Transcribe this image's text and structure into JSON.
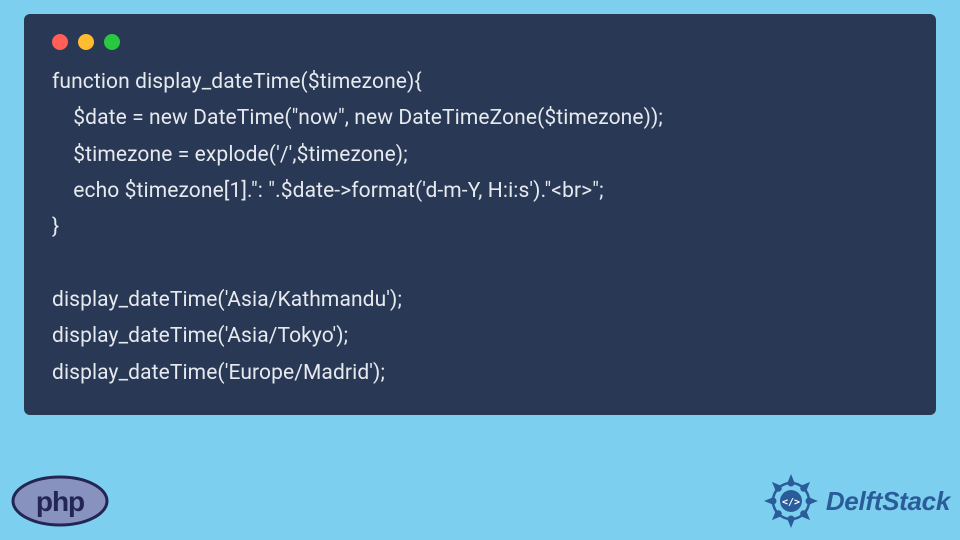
{
  "code": {
    "lines": [
      "function display_dateTime($timezone){",
      "    $date = new DateTime(\"now\", new DateTimeZone($timezone));",
      "    $timezone = explode('/',$timezone);",
      "    echo $timezone[1].\": \".$date->format('d-m-Y, H:i:s').\"<br>\";",
      "}",
      "",
      "display_dateTime('Asia/Kathmandu');",
      "display_dateTime('Asia/Tokyo');",
      "display_dateTime('Europe/Madrid');"
    ]
  },
  "footer": {
    "php_label": "php",
    "brand": "DelftStack"
  }
}
